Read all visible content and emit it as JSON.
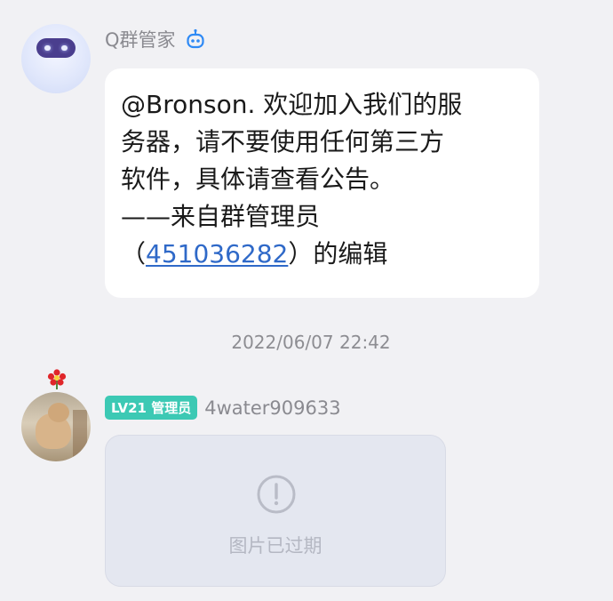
{
  "messages": [
    {
      "sender": "Q群管家",
      "sender_badge_icon": "robot-icon",
      "avatar_icon": "robot-avatar",
      "text_before_link": "@Bronson. 欢迎加入我们的服\n务器，请不要使用任何第三方\n软件，具体请查看公告。\n——来自群管理员\n（",
      "link": "451036282",
      "text_after_link": "）的编辑"
    },
    {
      "timestamp": "2022/06/07 22:42"
    },
    {
      "sender": "4water909633",
      "badge": "LV21 管理员",
      "avatar_icon": "cat-photo-avatar",
      "image_status": "图片已过期",
      "image_status_icon": "exclamation-circle-icon"
    }
  ],
  "colors": {
    "background": "#f1f1f4",
    "bubble": "#ffffff",
    "link": "#2f69c8",
    "level_badge": "#3cc9b4",
    "expired_placeholder": "#e4e7f0"
  }
}
